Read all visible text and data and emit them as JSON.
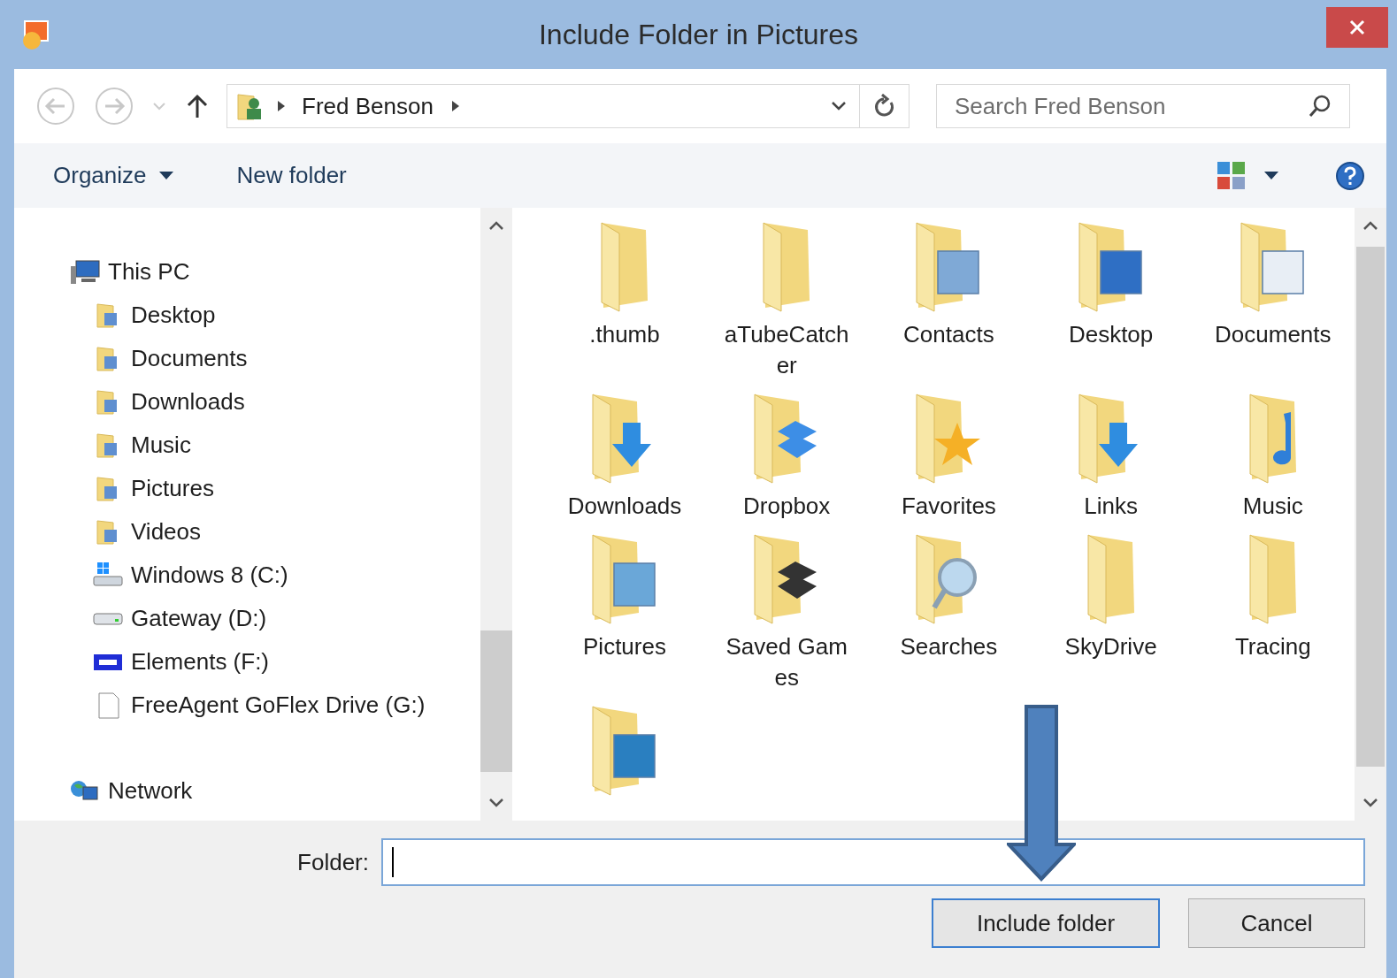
{
  "window": {
    "title": "Include Folder in Pictures"
  },
  "nav": {
    "breadcrumb": [
      {
        "label": "Fred Benson"
      }
    ],
    "search": {
      "placeholder": "Search Fred Benson"
    }
  },
  "toolbar": {
    "items": [
      {
        "label": "Organize",
        "dropdown": true
      },
      {
        "label": "New folder",
        "dropdown": false
      }
    ]
  },
  "tree": [
    {
      "label": "This PC",
      "kind": "pc",
      "children": [
        {
          "label": "Desktop",
          "kind": "folder"
        },
        {
          "label": "Documents",
          "kind": "folder"
        },
        {
          "label": "Downloads",
          "kind": "folder"
        },
        {
          "label": "Music",
          "kind": "folder"
        },
        {
          "label": "Pictures",
          "kind": "folder"
        },
        {
          "label": "Videos",
          "kind": "folder"
        },
        {
          "label": "Windows 8 (C:)",
          "kind": "system-drive"
        },
        {
          "label": "Gateway (D:)",
          "kind": "drive"
        },
        {
          "label": "Elements (F:)",
          "kind": "wd-drive"
        },
        {
          "label": "FreeAgent GoFlex Drive (G:)",
          "kind": "removable"
        }
      ]
    },
    {
      "label": "Network",
      "kind": "network"
    }
  ],
  "folders": [
    {
      "label": ".thumb",
      "kind": "plain"
    },
    {
      "label": "aTubeCatcher",
      "kind": "plain"
    },
    {
      "label": "Contacts",
      "kind": "contacts"
    },
    {
      "label": "Desktop",
      "kind": "desktop"
    },
    {
      "label": "Documents",
      "kind": "documents"
    },
    {
      "label": "Downloads",
      "kind": "downloads"
    },
    {
      "label": "Dropbox",
      "kind": "dropbox"
    },
    {
      "label": "Favorites",
      "kind": "favorites"
    },
    {
      "label": "Links",
      "kind": "links"
    },
    {
      "label": "Music",
      "kind": "music"
    },
    {
      "label": "Pictures",
      "kind": "pictures"
    },
    {
      "label": "Saved Games",
      "kind": "games"
    },
    {
      "label": "Searches",
      "kind": "searches"
    },
    {
      "label": "SkyDrive",
      "kind": "plain"
    },
    {
      "label": "Tracing",
      "kind": "plain"
    },
    {
      "kind": "videos"
    }
  ],
  "folder_field": {
    "label": "Folder:"
  },
  "buttons": [
    {
      "label": "Include folder",
      "default": true
    },
    {
      "label": "Cancel",
      "default": false
    }
  ]
}
